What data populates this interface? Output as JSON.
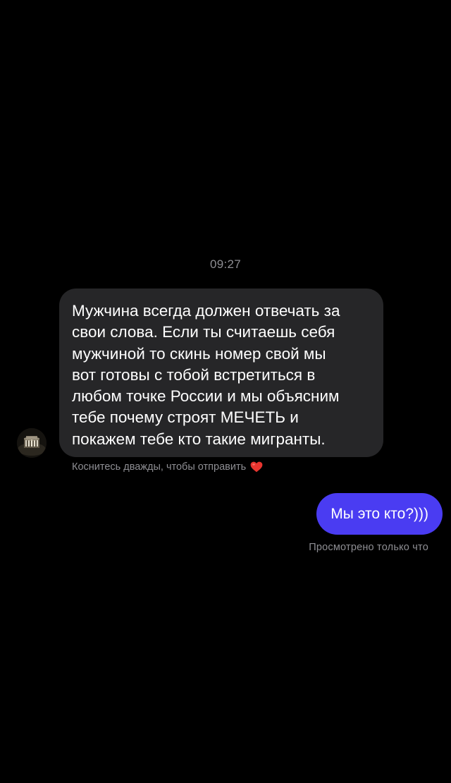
{
  "conversation": {
    "timestamp": "09:27",
    "incoming_message": {
      "text": "Мужчина всегда должен отвечать за\nсвои слова. Если ты считаешь себя\nмужчиной то скинь номер свой мы\nвот готовы с тобой встретиться в\nлюбом точке России и мы объясним\nтебе почему строят МЕЧЕТЬ и\nпокажем тебе кто такие мигранты.",
      "avatar_icon": "user-avatar",
      "hint": "Коснитесь дважды, чтобы отправить",
      "hint_icon": "red-heart-icon",
      "bubble_color": "#262628"
    },
    "outgoing_message": {
      "text": "Мы это кто?)))",
      "status": "Просмотрено только что",
      "bubble_color": "#4a3cf2"
    }
  },
  "colors": {
    "background": "#000000",
    "muted_text": "#8e8e93",
    "heart": "#e8352f"
  }
}
